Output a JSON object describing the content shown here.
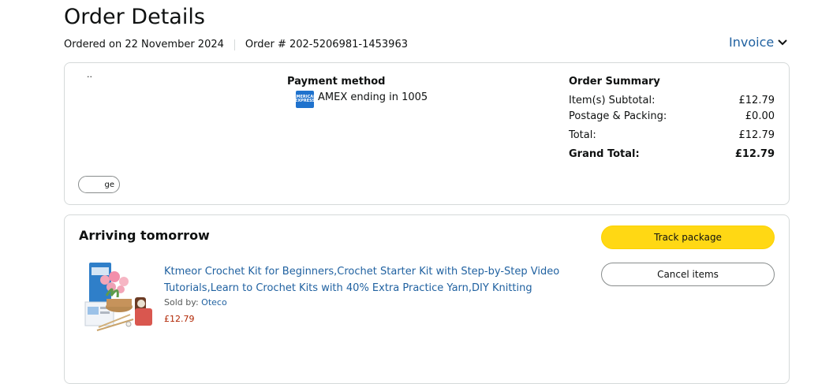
{
  "header": {
    "title": "Order Details",
    "ordered_on": "Ordered on 22 November 2024",
    "order_number": "Order # 202-5206981-1453963",
    "invoice_label": "Invoice"
  },
  "details_card": {
    "address_fragment": "··",
    "payment": {
      "title": "Payment method",
      "card_text": "AMEX ending in 1005",
      "card_icon": "amex-card-icon"
    },
    "summary": {
      "title": "Order Summary",
      "rows": [
        {
          "label": "Item(s) Subtotal:",
          "value": "£12.79"
        },
        {
          "label": "Postage & Packing:",
          "value": "£0.00"
        },
        {
          "label": "Total:",
          "value": "£12.79"
        },
        {
          "label": "Grand Total:",
          "value": "£12.79"
        }
      ]
    },
    "pill_fragment": "ge"
  },
  "shipment_card": {
    "status": "Arriving tomorrow",
    "product": {
      "title": "Ktmeor Crochet Kit for Beginners,Crochet Starter Kit with Step-by-Step Video Tutorials,Learn to Crochet Kits with 40% Extra Practice Yarn,DIY Knitting",
      "sold_by_label": "Sold by:",
      "seller": "Oteco",
      "price": "£12.79"
    },
    "track_button": "Track package",
    "cancel_button": "Cancel items"
  },
  "colors": {
    "link": "#2162a1",
    "price": "#b12704",
    "track_button": "#ffd814",
    "border": "#d5d9d9"
  }
}
